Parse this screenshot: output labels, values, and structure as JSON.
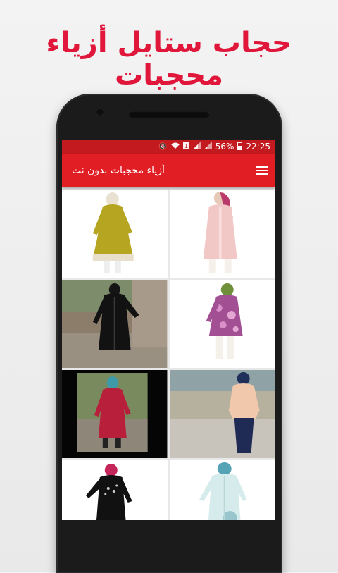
{
  "promo": {
    "title": "حجاب ستايل أزياء محجبات"
  },
  "status_bar": {
    "battery": "56%",
    "time": "22:25"
  },
  "app_bar": {
    "title": "أزياء محجبات بدون نت"
  },
  "colors": {
    "brand_red": "#e01e24",
    "status_red": "#c21a1f",
    "promo_red": "#e0163b"
  },
  "icons": [
    "mute-icon",
    "wifi-icon",
    "sim-icon",
    "signal-icon",
    "battery-icon",
    "menu-icon"
  ],
  "gallery": [
    {
      "name": "mustard-tunic-outfit"
    },
    {
      "name": "pink-coat-outfit"
    },
    {
      "name": "black-abaya-outfit"
    },
    {
      "name": "floral-tunic-outfit"
    },
    {
      "name": "burgundy-coat-outfit"
    },
    {
      "name": "peplum-navy-outfit"
    },
    {
      "name": "black-embellished-outfit"
    },
    {
      "name": "white-coat-outfit"
    }
  ]
}
